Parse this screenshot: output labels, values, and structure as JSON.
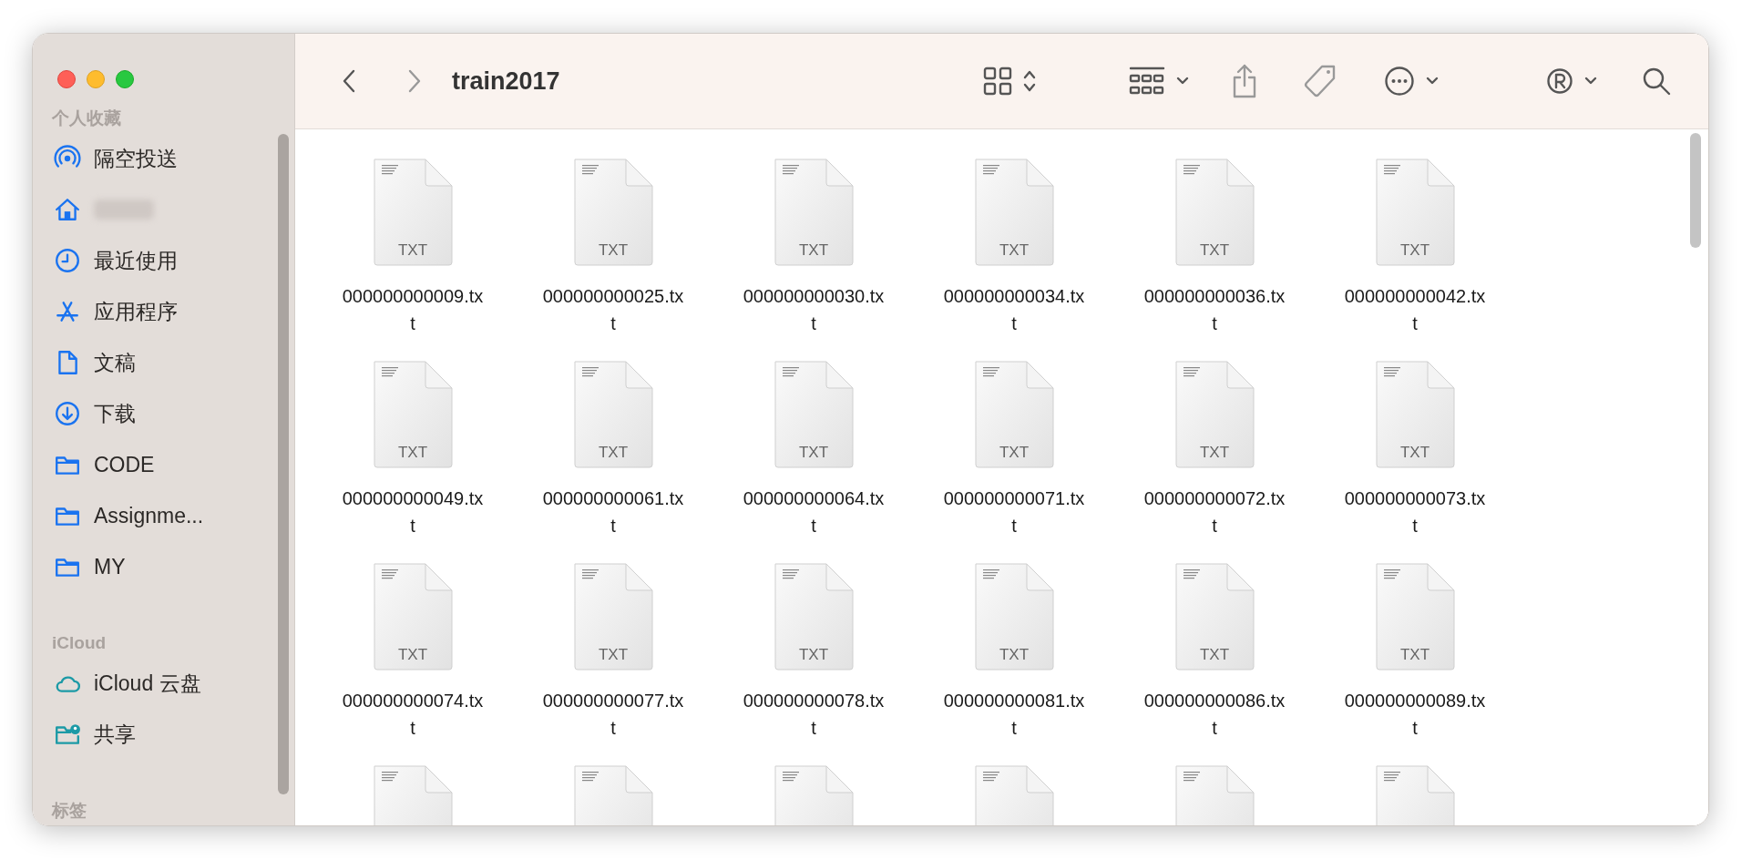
{
  "window": {
    "title": "train2017"
  },
  "toolbar": {
    "back_enabled": true,
    "forward_enabled": false
  },
  "sidebar": {
    "sections": [
      {
        "title": "个人收藏",
        "items": [
          {
            "kind": "airdrop",
            "label": "隔空投送"
          },
          {
            "kind": "home",
            "redacted": true
          },
          {
            "kind": "clock",
            "label": "最近使用"
          },
          {
            "kind": "apps",
            "label": "应用程序"
          },
          {
            "kind": "document",
            "label": "文稿"
          },
          {
            "kind": "download",
            "label": "下载"
          },
          {
            "kind": "folder",
            "label": "CODE"
          },
          {
            "kind": "folder",
            "label": "Assignme..."
          },
          {
            "kind": "folder",
            "label": "MY"
          }
        ]
      },
      {
        "title": "iCloud",
        "items": [
          {
            "kind": "cloud",
            "label": "iCloud 云盘"
          },
          {
            "kind": "shared",
            "label": "共享"
          }
        ]
      },
      {
        "title": "标签"
      }
    ]
  },
  "files": [
    {
      "kind": "file",
      "name": "000000000009.txt",
      "badge": "TXT"
    },
    {
      "kind": "file",
      "name": "000000000025.txt",
      "badge": "TXT"
    },
    {
      "kind": "file",
      "name": "000000000030.txt",
      "badge": "TXT"
    },
    {
      "kind": "file",
      "name": "000000000034.txt",
      "badge": "TXT"
    },
    {
      "kind": "file",
      "name": "000000000036.txt",
      "badge": "TXT"
    },
    {
      "kind": "file",
      "name": "000000000042.txt",
      "badge": "TXT"
    },
    {
      "kind": "file",
      "name": "000000000049.txt",
      "badge": "TXT"
    },
    {
      "kind": "file",
      "name": "000000000061.txt",
      "badge": "TXT"
    },
    {
      "kind": "file",
      "name": "000000000064.txt",
      "badge": "TXT"
    },
    {
      "kind": "file",
      "name": "000000000071.txt",
      "badge": "TXT"
    },
    {
      "kind": "file",
      "name": "000000000072.txt",
      "badge": "TXT"
    },
    {
      "kind": "file",
      "name": "000000000073.txt",
      "badge": "TXT"
    },
    {
      "kind": "file",
      "name": "000000000074.txt",
      "badge": "TXT"
    },
    {
      "kind": "file",
      "name": "000000000077.txt",
      "badge": "TXT"
    },
    {
      "kind": "file",
      "name": "000000000078.txt",
      "badge": "TXT"
    },
    {
      "kind": "file",
      "name": "000000000081.txt",
      "badge": "TXT"
    },
    {
      "kind": "file",
      "name": "000000000086.txt",
      "badge": "TXT"
    },
    {
      "kind": "file",
      "name": "000000000089.txt",
      "badge": "TXT"
    },
    {
      "kind": "cut-off"
    },
    {
      "kind": "cut-off"
    },
    {
      "kind": "cut-off"
    },
    {
      "kind": "cut-off"
    },
    {
      "kind": "cut-off"
    },
    {
      "kind": "cut-off"
    }
  ]
}
